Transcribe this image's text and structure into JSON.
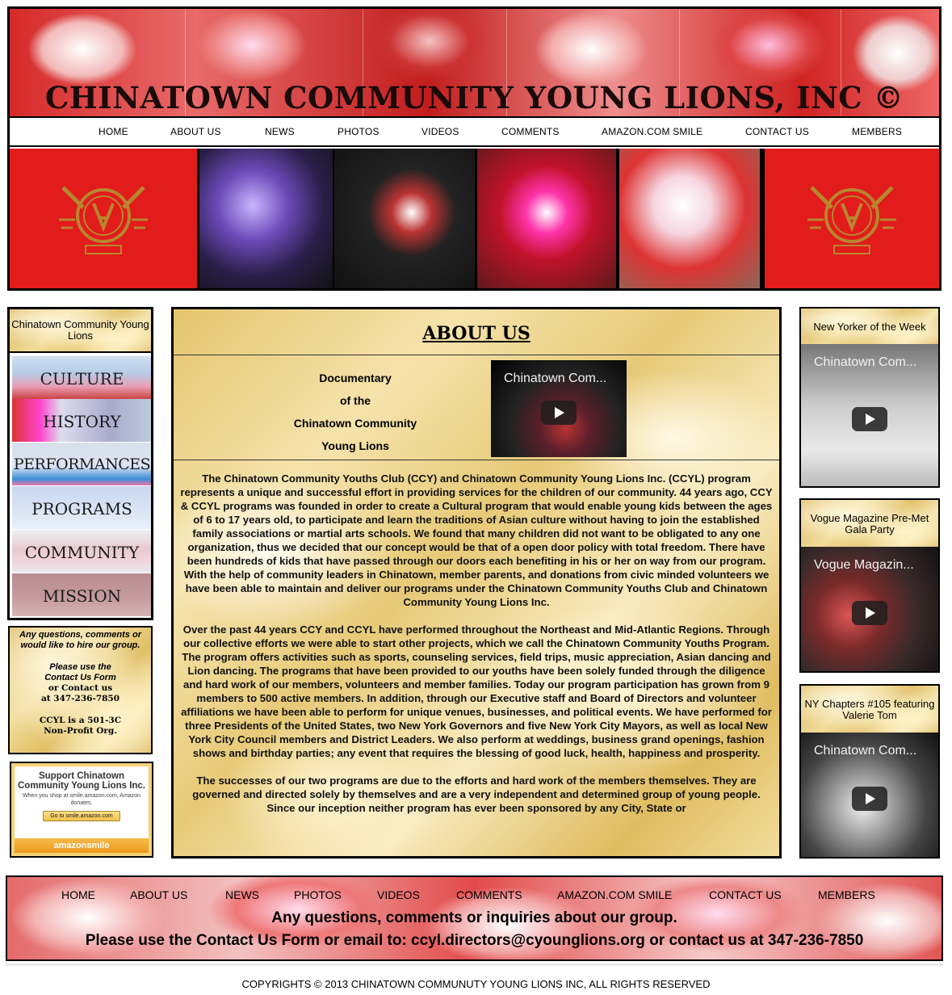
{
  "header": {
    "site_title": "CHINATOWN COMMUNITY YOUNG LIONS, INC ©",
    "nav": [
      "HOME",
      "ABOUT US",
      "NEWS",
      "PHOTOS",
      "VIDEOS",
      "COMMENTS",
      "AMAZON.COM SMILE",
      "CONTACT US",
      "MEMBERS"
    ]
  },
  "left_sidebar": {
    "title": "Chinatown Community Young Lions",
    "links": [
      "CULTURE",
      "HISTORY",
      "PERFORMANCES",
      "PROGRAMS",
      "COMMUNITY",
      "MISSION"
    ],
    "info": {
      "line1": "Any questions, comments or would like to hire our group.",
      "line2": "Please use the Contact Us Form",
      "line3": "or Contact us",
      "line4": "at 347-236-7850",
      "line5": "CCYL is a 501-3C Non-Profit Org."
    },
    "amazon": {
      "support": "Support Chinatown Community Young Lions Inc.",
      "small": "When you shop at smile.amazon.com, Amazon donates.",
      "button": "Go to smile.amazon.com",
      "brand": "amazonsmile"
    }
  },
  "main": {
    "heading": "ABOUT US",
    "doc_caption": [
      "Documentary",
      "of the",
      "Chinatown Community",
      "Young Lions"
    ],
    "doc_video_title": "Chinatown Com...",
    "paragraphs": [
      "The Chinatown Community Youths Club (CCY) and Chinatown Community Young Lions Inc. (CCYL) program represents a unique and successful effort in providing services for the children of our community. 44 years ago, CCY & CCYL programs was founded in order to create a Cultural program that would enable young kids between the ages of 6 to 17 years old, to participate and learn the traditions of Asian culture without having to join the established family associations or martial arts schools. We found that many children did not want to be obligated to any one organization, thus we decided that our concept would be that of a open door policy with total freedom. There have been hundreds of kids that have passed through our doors each benefiting in his or her on way from our program. With the help of community leaders in Chinatown, member parents, and donations from civic minded volunteers we have been able to maintain and deliver our programs under the Chinatown Community Youths Club and Chinatown Community Young Lions Inc.",
      "Over the past 44 years CCY and CCYL have performed throughout the Northeast and Mid-Atlantic Regions.  Through our collective efforts we were able to start other projects, which we call the Chinatown Community Youths Program. The program offers activities such as sports, counseling services, field trips, music appreciation, Asian dancing and Lion dancing. The programs that have been provided to our youths have been solely funded through the diligence and hard work of our members, volunteers and member families. Today our program participation has grown from 9 members to 500 active members. In addition, through our Executive staff and Board of Directors and volunteer affiliations we have been able to perform for unique venues, businesses, and political events.  We have performed for three Presidents of the United States, two New York Governors and five New York City Mayors, as well as local New York City Council members and District Leaders. We also perform at weddings, business grand openings, fashion shows and birthday parties; any event that requires the blessing of good luck, health, happiness and prosperity.",
      "The successes of our two programs are due to the efforts and hard work of the members themselves. They are governed and directed solely by themselves and are a very independent and determined group of young people. Since our inception neither program has ever been sponsored by any City, State or"
    ]
  },
  "right_sidebar": [
    {
      "title": "New Yorker of the Week",
      "video_title": "Chinatown Com..."
    },
    {
      "title": "Vogue Magazine Pre-Met Gala Party",
      "video_title": "Vogue Magazin..."
    },
    {
      "title": "NY Chapters #105 featuring Valerie Tom",
      "video_title": "Chinatown Com..."
    }
  ],
  "footer": {
    "nav": [
      "HOME",
      "ABOUT US",
      "NEWS",
      "PHOTOS",
      "VIDEOS",
      "COMMENTS",
      "AMAZON.COM SMILE",
      "CONTACT US",
      "MEMBERS"
    ],
    "line1": "Any questions, comments or inquiries about our group.",
    "line2": "Please use the Contact Us Form or email to: ccyl.directors@cyounglions.org or contact us at 347-236-7850",
    "copyright": "COPYRIGHTS © 2013 CHINATOWN COMMUNUTY YOUNG LIONS INC, ALL RIGHTS RESERVED"
  },
  "colors": {
    "accent_red": "#e21b1b",
    "gold": "#e4c56f"
  },
  "icons": [
    "play-icon",
    "lion-emblem-logo"
  ]
}
